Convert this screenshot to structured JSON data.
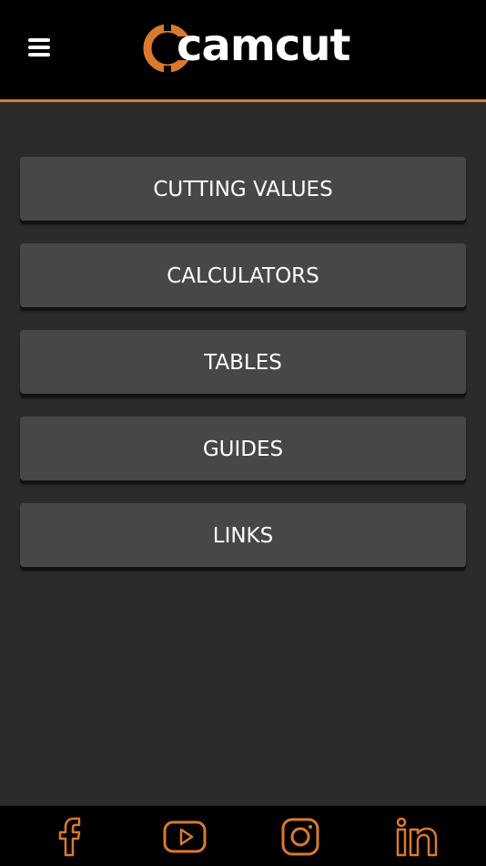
{
  "header": {
    "logo_text": "camcut",
    "menu_icon": "hamburger-menu-icon"
  },
  "menu": {
    "items": [
      {
        "label": "CUTTING VALUES"
      },
      {
        "label": "CALCULATORS"
      },
      {
        "label": "TABLES"
      },
      {
        "label": "GUIDES"
      },
      {
        "label": "LINKS"
      }
    ]
  },
  "footer": {
    "social": [
      "facebook-icon",
      "youtube-icon",
      "instagram-icon",
      "linkedin-icon"
    ]
  },
  "colors": {
    "accent": "#d97a2c",
    "background": "#2b2b2b",
    "button": "#474747",
    "header": "#000000"
  }
}
